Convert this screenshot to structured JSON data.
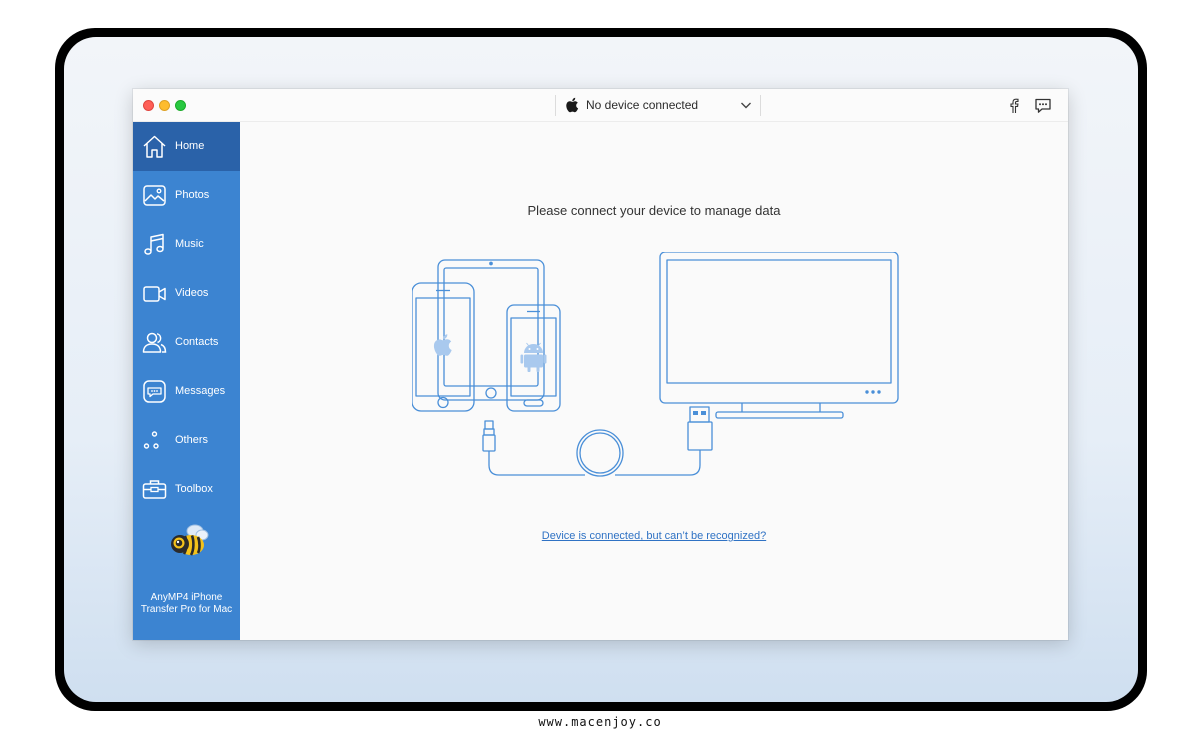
{
  "titlebar": {
    "device_label": "No device connected",
    "icons": [
      "apple-icon",
      "chevron-down-icon",
      "facebook-icon",
      "chat-icon"
    ]
  },
  "sidebar": {
    "items": [
      {
        "label": "Home",
        "icon": "home-icon",
        "active": true
      },
      {
        "label": "Photos",
        "icon": "photo-icon",
        "active": false
      },
      {
        "label": "Music",
        "icon": "music-icon",
        "active": false
      },
      {
        "label": "Videos",
        "icon": "video-icon",
        "active": false
      },
      {
        "label": "Contacts",
        "icon": "contacts-icon",
        "active": false
      },
      {
        "label": "Messages",
        "icon": "message-icon",
        "active": false
      },
      {
        "label": "Others",
        "icon": "dots-icon",
        "active": false
      },
      {
        "label": "Toolbox",
        "icon": "toolbox-icon",
        "active": false
      }
    ],
    "brand_line1": "AnyMP4 iPhone",
    "brand_line2": "Transfer Pro for Mac"
  },
  "main": {
    "prompt": "Please connect your device to manage data",
    "help_link": "Device is connected, but can’t be recognized?"
  },
  "watermark": "www.macenjoy.co",
  "colors": {
    "sidebar": "#3c84d1",
    "sidebar_active": "#2a62a9",
    "illustration_stroke": "#4a8fd8",
    "link": "#2f72c4"
  }
}
